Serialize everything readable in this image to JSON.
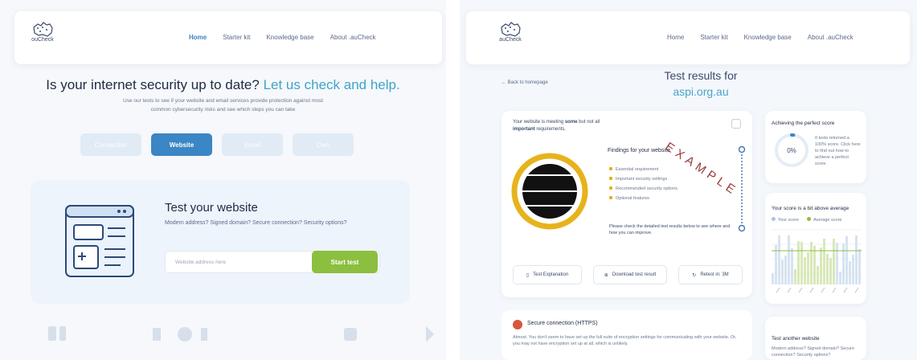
{
  "left": {
    "logo": {
      "word": "ouCheck"
    },
    "nav": [
      {
        "label": "Home",
        "active": true
      },
      {
        "label": "Starter kit",
        "active": false
      },
      {
        "label": "Knowledge base",
        "active": false
      },
      {
        "label": "About .auCheck",
        "active": false
      }
    ],
    "hero": {
      "title_main": "Is your internet security up to date?",
      "title_accent": "Let us check and help.",
      "description": "Use our tests to see if your website and email services provide protection against most common cybersecurity risks and see which steps you can take"
    },
    "tabs": [
      {
        "label": "Connection",
        "active": false
      },
      {
        "label": "Website",
        "active": true
      },
      {
        "label": "Email",
        "active": false
      },
      {
        "label": "Own",
        "active": false
      }
    ],
    "test": {
      "title": "Test your website",
      "subtitle": "Modern address? Signed domain? Secure connection? Security options?",
      "input_placeholder": "Website address here",
      "button": "Start test"
    }
  },
  "right": {
    "logo": {
      "word": "auCheck"
    },
    "nav": [
      {
        "label": "Home"
      },
      {
        "label": "Starter kit"
      },
      {
        "label": "Knowledge base"
      },
      {
        "label": "About .auCheck"
      }
    ],
    "back_link": "← Back to homepage",
    "results": {
      "title": "Test results for",
      "domain": "aspi.org.au"
    },
    "summary": {
      "pre": "Your website is meeting ",
      "bold1": "some",
      "mid": " but not all ",
      "bold2": "important",
      "post": " requirements."
    },
    "findings": {
      "title": "Findings for your website",
      "items": [
        {
          "label": "Essential requirement",
          "color": "#e0b51f"
        },
        {
          "label": "Important security settings",
          "color": "#e0b51f"
        },
        {
          "label": "Recommended security options",
          "color": "#e0b51f"
        },
        {
          "label": "Optional features",
          "color": "#e0b51f"
        }
      ],
      "note": "Please check the detailed test results below to see where and how you can improve."
    },
    "watermark": "EXAMPLE",
    "actions": [
      {
        "label": "Test Explanation",
        "icon": "book-icon"
      },
      {
        "label": "Download test result",
        "icon": "download-icon"
      },
      {
        "label": "Retest in: 3M",
        "icon": "refresh-icon"
      }
    ],
    "perfect_score": {
      "title": "Achieving the perfect score",
      "percent": "0%",
      "percent_value": 0.02,
      "text": "0 tests returned a 100% score. Click here to find out how to achieve a perfect score."
    },
    "score_compare": {
      "title": "Your score is a bit above average",
      "legend": [
        {
          "label": "Your score",
          "color": "#a9c4e4"
        },
        {
          "label": "Average score",
          "color": "#8cbf3f"
        }
      ]
    },
    "issue": {
      "title": "Secure connection (HTTPS)",
      "text": "Almost. You don't seem to have set up the full suite of encryption settings for communicating with your website. Or, you may not have encryption set up at all, which is unlikely."
    },
    "another": {
      "title": "Test another website",
      "text": "Modern address? Signed domain? Secure connection? Security options?"
    }
  }
}
